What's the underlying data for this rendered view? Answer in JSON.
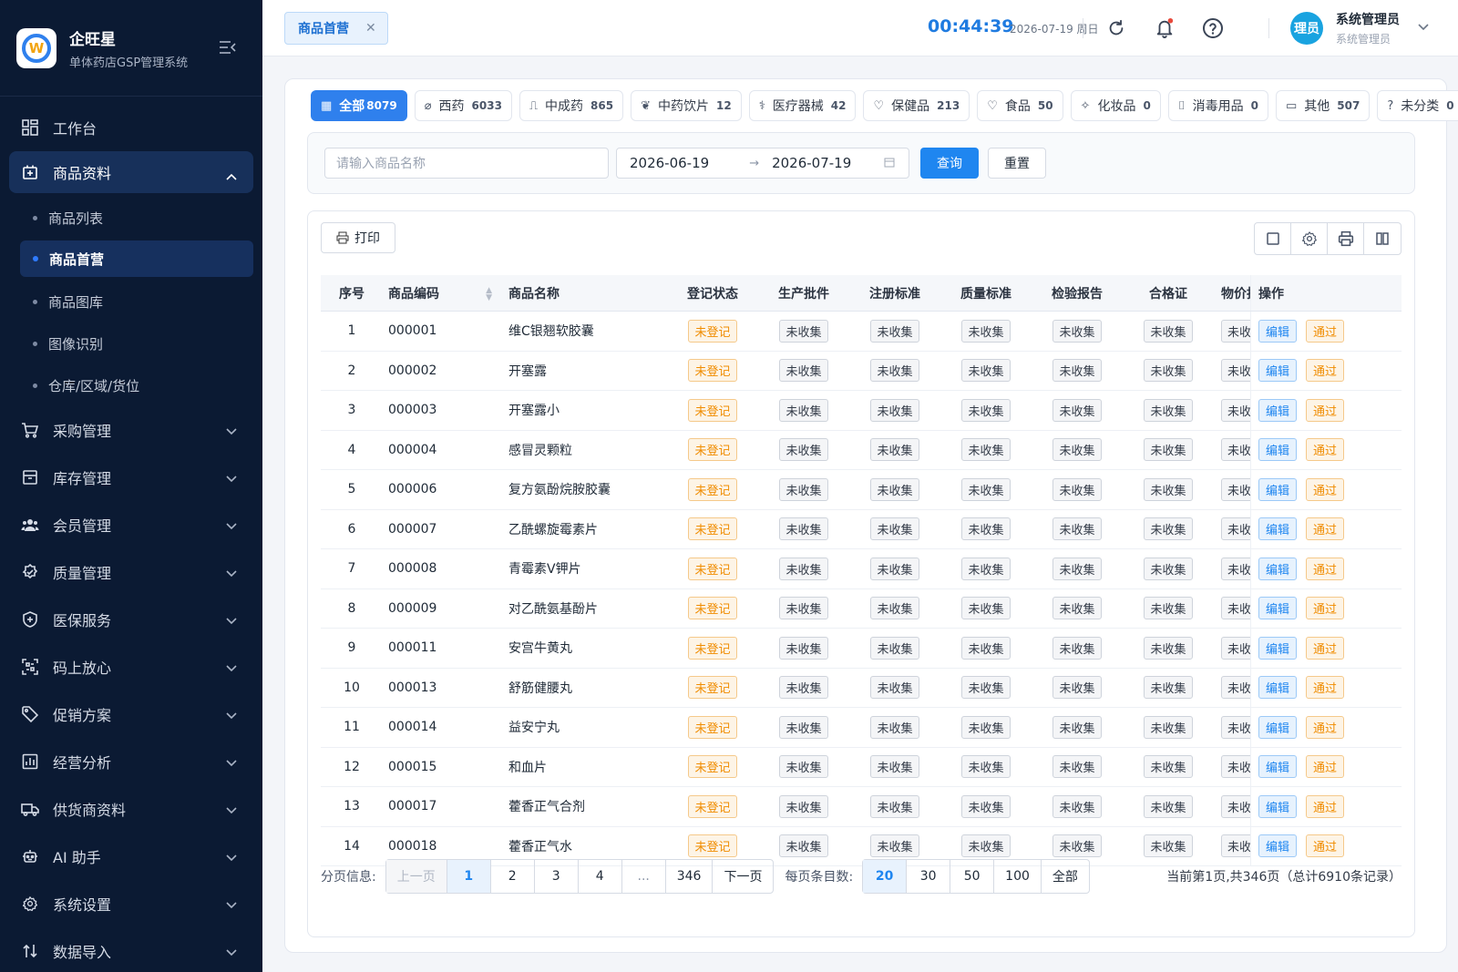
{
  "brand": {
    "name": "企旺星",
    "subtitle": "单体药店GSP管理系统",
    "logo_letter": "W"
  },
  "sidebar": {
    "items": [
      {
        "label": "工作台",
        "icon": "dashboard-icon",
        "expandable": false
      },
      {
        "label": "商品资料",
        "icon": "goods-icon",
        "expandable": true,
        "open": true,
        "children": [
          "商品列表",
          "商品首营",
          "商品图库",
          "图像识别",
          "仓库/区域/货位"
        ],
        "active_child": "商品首营"
      },
      {
        "label": "采购管理",
        "icon": "cart-icon",
        "expandable": true
      },
      {
        "label": "库存管理",
        "icon": "inventory-icon",
        "expandable": true
      },
      {
        "label": "会员管理",
        "icon": "members-icon",
        "expandable": true
      },
      {
        "label": "质量管理",
        "icon": "quality-check-icon",
        "expandable": true
      },
      {
        "label": "医保服务",
        "icon": "shield-plus-icon",
        "expandable": true
      },
      {
        "label": "码上放心",
        "icon": "scan-code-icon",
        "expandable": true
      },
      {
        "label": "促销方案",
        "icon": "tag-icon",
        "expandable": true
      },
      {
        "label": "经营分析",
        "icon": "chart-icon",
        "expandable": true
      },
      {
        "label": "供货商资料",
        "icon": "truck-icon",
        "expandable": true
      },
      {
        "label": "AI 助手",
        "icon": "robot-icon",
        "expandable": true
      },
      {
        "label": "系统设置",
        "icon": "gear-icon",
        "expandable": true
      },
      {
        "label": "数据导入",
        "icon": "import-icon",
        "expandable": true
      }
    ]
  },
  "header": {
    "active_tab": "商品首营",
    "clock": "00:44:39",
    "date": "2026-07-19 周日",
    "user": {
      "avatar_text": "理员",
      "name": "系统管理员",
      "role": "系统管理员"
    }
  },
  "categories": [
    {
      "label": "全部",
      "count": "8079",
      "icon": "grid-icon",
      "active": true
    },
    {
      "label": "西药",
      "count": "6033",
      "icon": "pill-icon"
    },
    {
      "label": "中成药",
      "count": "865",
      "icon": "tray-icon"
    },
    {
      "label": "中药饮片",
      "count": "12",
      "icon": "leaf-icon"
    },
    {
      "label": "医疗器械",
      "count": "42",
      "icon": "stethoscope-icon"
    },
    {
      "label": "保健品",
      "count": "213",
      "icon": "heart-pulse-icon"
    },
    {
      "label": "食品",
      "count": "50",
      "icon": "heart-icon"
    },
    {
      "label": "化妆品",
      "count": "0",
      "icon": "sparkle-icon"
    },
    {
      "label": "消毒用品",
      "count": "0",
      "icon": "spray-icon"
    },
    {
      "label": "其他",
      "count": "507",
      "icon": "box-icon"
    },
    {
      "label": "未分类",
      "count": "0",
      "icon": "question-icon"
    }
  ],
  "search": {
    "name_placeholder": "请输入商品名称",
    "date_start": "2026-06-19",
    "date_end": "2026-07-19",
    "query_label": "查询",
    "reset_label": "重置"
  },
  "toolbar": {
    "print_label": "打印"
  },
  "table": {
    "columns": [
      "序号",
      "商品编码",
      "商品名称",
      "登记状态",
      "生产批件",
      "注册标准",
      "质量标准",
      "检验报告",
      "合格证",
      "物价批",
      "操作"
    ],
    "status_label": "未登记",
    "uncollected_label": "未收集",
    "edit_label": "编辑",
    "pass_label": "通过",
    "rows": [
      {
        "idx": "1",
        "code": "000001",
        "name": "维C银翘软胶囊"
      },
      {
        "idx": "2",
        "code": "000002",
        "name": "开塞露"
      },
      {
        "idx": "3",
        "code": "000003",
        "name": "开塞露小"
      },
      {
        "idx": "4",
        "code": "000004",
        "name": "感冒灵颗粒"
      },
      {
        "idx": "5",
        "code": "000006",
        "name": "复方氨酚烷胺胶囊"
      },
      {
        "idx": "6",
        "code": "000007",
        "name": "乙酰螺旋霉素片"
      },
      {
        "idx": "7",
        "code": "000008",
        "name": "青霉素V钾片"
      },
      {
        "idx": "8",
        "code": "000009",
        "name": "对乙酰氨基酚片"
      },
      {
        "idx": "9",
        "code": "000011",
        "name": "安宫牛黄丸"
      },
      {
        "idx": "10",
        "code": "000013",
        "name": "舒筋健腰丸"
      },
      {
        "idx": "11",
        "code": "000014",
        "name": "益安宁丸"
      },
      {
        "idx": "12",
        "code": "000015",
        "name": "和血片"
      },
      {
        "idx": "13",
        "code": "000017",
        "name": "藿香正气合剂"
      },
      {
        "idx": "14",
        "code": "000018",
        "name": "藿香正气水"
      }
    ]
  },
  "pagination": {
    "label": "分页信息:",
    "prev": "上一页",
    "pages": [
      "1",
      "2",
      "3",
      "4",
      "...",
      "346"
    ],
    "current": "1",
    "next": "下一页",
    "size_label": "每页条目数:",
    "sizes": [
      "20",
      "30",
      "50",
      "100",
      "全部"
    ],
    "current_size": "20",
    "summary": "当前第1页,共346页（总计6910条记录）"
  }
}
